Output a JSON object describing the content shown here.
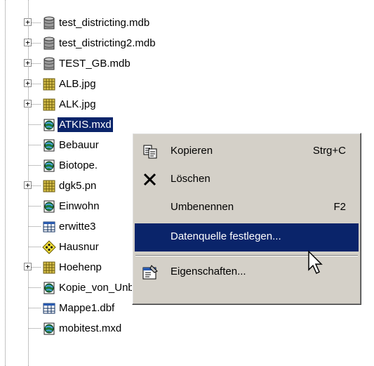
{
  "tree": {
    "items": [
      {
        "label": "test_districting.mdb",
        "icon": "database-icon",
        "expander": "+"
      },
      {
        "label": "test_districting2.mdb",
        "icon": "database-icon",
        "expander": "+"
      },
      {
        "label": "TEST_GB.mdb",
        "icon": "database-icon",
        "expander": "+"
      },
      {
        "label": "ALB.jpg",
        "icon": "raster-image-icon",
        "expander": "+"
      },
      {
        "label": "ALK.jpg",
        "icon": "raster-image-icon",
        "expander": "+"
      },
      {
        "label": "ATKIS.mxd",
        "icon": "map-document-icon",
        "expander": "",
        "selected": true
      },
      {
        "label": "Bebauur",
        "icon": "map-document-icon",
        "expander": ""
      },
      {
        "label": "Biotope.",
        "icon": "map-document-icon",
        "expander": ""
      },
      {
        "label": "dgk5.pn",
        "icon": "raster-image-icon",
        "expander": "+"
      },
      {
        "label": "Einwohn",
        "icon": "map-document-icon",
        "expander": ""
      },
      {
        "label": "erwitte3",
        "icon": "table-icon",
        "expander": ""
      },
      {
        "label": "Hausnur",
        "icon": "address-locator-icon",
        "expander": ""
      },
      {
        "label": "Hoehenp",
        "icon": "raster-image-icon",
        "expander": "+"
      },
      {
        "label": "Kopie_von_Unbenannt.mxd",
        "icon": "map-document-icon",
        "expander": ""
      },
      {
        "label": "Mappe1.dbf",
        "icon": "table-icon",
        "expander": ""
      },
      {
        "label": "mobitest.mxd",
        "icon": "map-document-icon",
        "expander": ""
      }
    ]
  },
  "context_menu": {
    "copy": {
      "label": "Kopieren",
      "shortcut": "Strg+C",
      "icon": "copy-icon"
    },
    "delete": {
      "label": "Löschen",
      "icon": "delete-x-icon"
    },
    "rename": {
      "label": "Umbenennen",
      "shortcut": "F2"
    },
    "set_data_source": {
      "label": "Datenquelle festlegen..."
    },
    "properties": {
      "label": "Eigenschaften...",
      "icon": "properties-icon"
    }
  },
  "colors": {
    "selection": "#0a246a",
    "menu_background": "#d4d0c8"
  }
}
